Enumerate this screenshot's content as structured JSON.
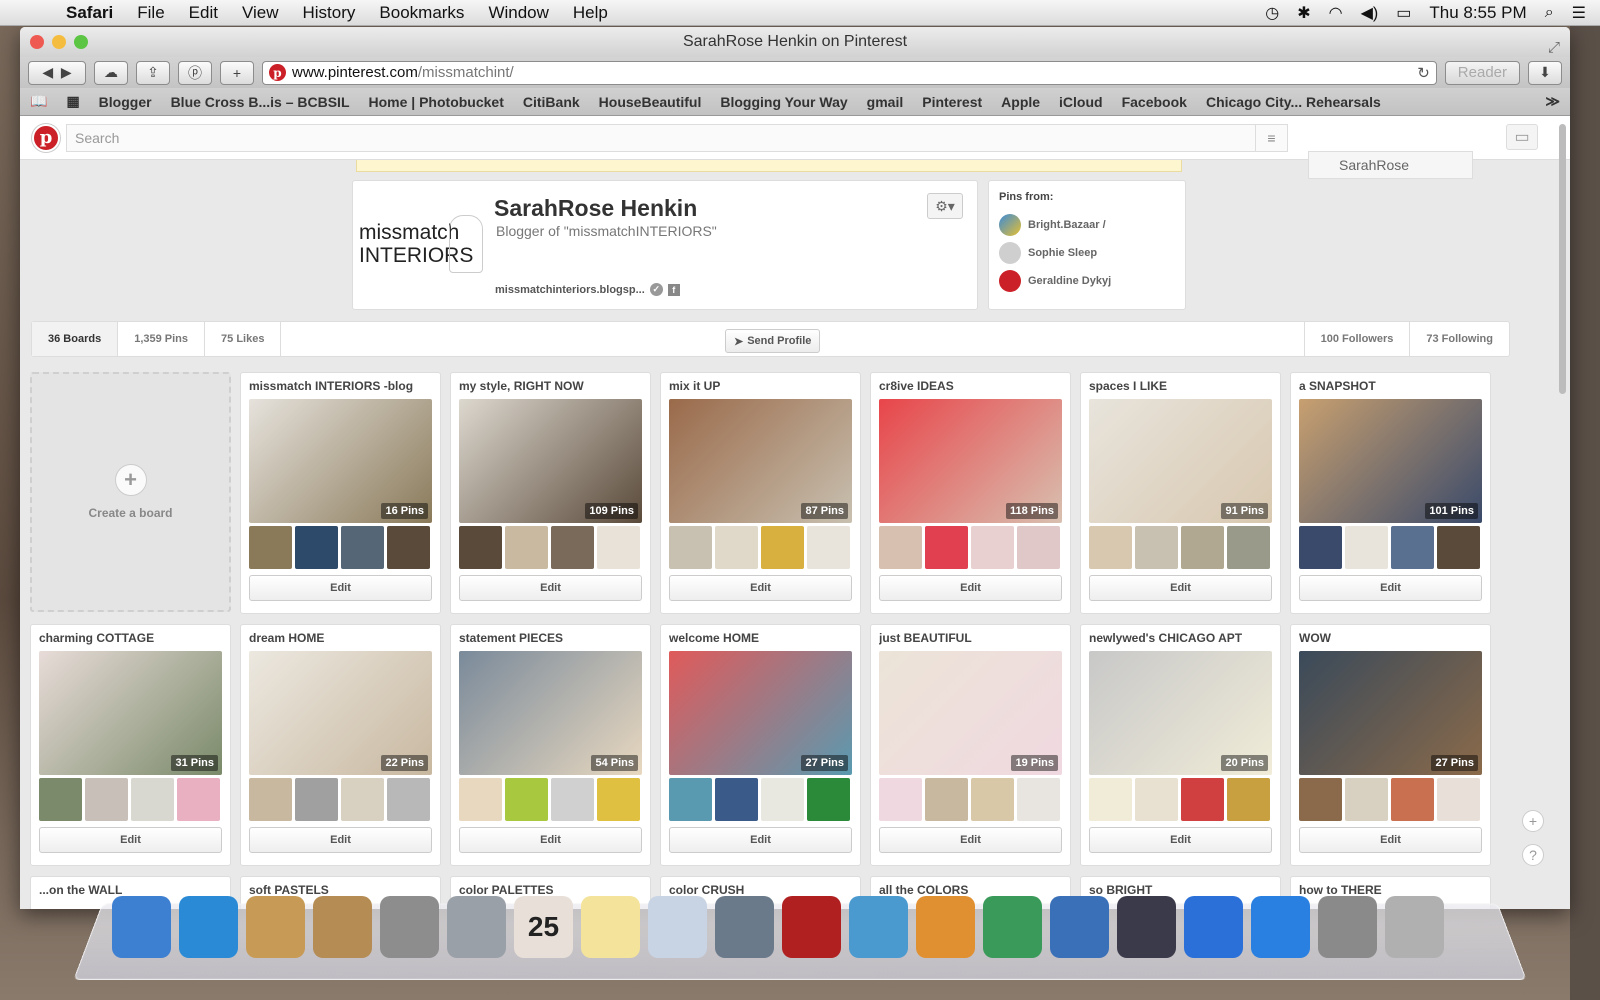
{
  "menubar": {
    "app": "Safari",
    "items": [
      "File",
      "Edit",
      "View",
      "History",
      "Bookmarks",
      "Window",
      "Help"
    ],
    "clock": "Thu 8:55 PM"
  },
  "window": {
    "title": "SarahRose Henkin on Pinterest",
    "url_host": "www.pinterest.com",
    "url_path": "/missmatchint/",
    "reader_label": "Reader"
  },
  "bookmarks": [
    "Blogger",
    "Blue Cross B...is – BCBSIL",
    "Home | Photobucket",
    "CitiBank",
    "HouseBeautiful",
    "Blogging Your Way",
    "gmail",
    "Pinterest",
    "Apple",
    "iCloud",
    "Facebook",
    "Chicago City... Rehearsals"
  ],
  "pinterest": {
    "search_placeholder": "Search",
    "user_button": "SarahRose",
    "profile": {
      "logo_line1": "missmatch",
      "logo_line2": "INTERIORS",
      "name": "SarahRose Henkin",
      "bio": "Blogger of \"missmatchINTERIORS\"",
      "link": "missmatchinteriors.blogsp..."
    },
    "pins_from": {
      "heading": "Pins from:",
      "sources": [
        "Bright.Bazaar /",
        "Sophie Sleep",
        "Geraldine Dykyj"
      ]
    },
    "tabs": {
      "boards": "36 Boards",
      "pins": "1,359 Pins",
      "likes": "75 Likes",
      "send": "Send Profile",
      "followers": "100 Followers",
      "following": "73 Following"
    },
    "create_board": "Create a board",
    "edit_label": "Edit",
    "boards": [
      {
        "title": "missmatch INTERIORS -blog",
        "count": "16 Pins",
        "colors": [
          "#e6e2dc",
          "#8a7a5a",
          "#2d4a6a",
          "#556677",
          "#5a4a3a"
        ]
      },
      {
        "title": "my style, RIGHT NOW",
        "count": "109 Pins",
        "colors": [
          "#ddd8cf",
          "#5a4a3a",
          "#c9b9a0",
          "#7a6a5a",
          "#e8e2d8"
        ]
      },
      {
        "title": "mix it UP",
        "count": "87 Pins",
        "colors": [
          "#9a6a4a",
          "#c8c0b0",
          "#e0d8c8",
          "#d8b040",
          "#e8e4dc"
        ]
      },
      {
        "title": "cr8ive IDEAS",
        "count": "118 Pins",
        "colors": [
          "#e8454a",
          "#d8c0b0",
          "#e04050",
          "#e8d0d0",
          "#e0c8c8"
        ]
      },
      {
        "title": "spaces I LIKE",
        "count": "91 Pins",
        "colors": [
          "#e8e4dc",
          "#d8c8b0",
          "#c8c0b0",
          "#b0a890",
          "#9a9a8a"
        ]
      },
      {
        "title": "a SNAPSHOT",
        "count": "101 Pins",
        "colors": [
          "#c8a070",
          "#3a4a6a",
          "#e8e4dc",
          "#5a7090",
          "#5a4a3a"
        ]
      },
      {
        "title": "charming COTTAGE",
        "count": "31 Pins",
        "colors": [
          "#e8dcd8",
          "#7a8a6a",
          "#c8c0b8",
          "#d8d8d0",
          "#e8b0c0"
        ]
      },
      {
        "title": "dream HOME",
        "count": "22 Pins",
        "colors": [
          "#ece8e0",
          "#c8b8a0",
          "#a0a0a0",
          "#d8d0c0",
          "#b8b8b8"
        ]
      },
      {
        "title": "statement PIECES",
        "count": "54 Pins",
        "colors": [
          "#7a8a9a",
          "#e8d8c0",
          "#a8c840",
          "#d0d0d0",
          "#e0c040"
        ]
      },
      {
        "title": "welcome HOME",
        "count": "27 Pins",
        "colors": [
          "#e05a5a",
          "#5a9ab0",
          "#3a5a8a",
          "#e8e8e0",
          "#2a8a3a"
        ]
      },
      {
        "title": "just BEAUTIFUL",
        "count": "19 Pins",
        "colors": [
          "#ece4d8",
          "#f0d8e0",
          "#c8b8a0",
          "#d8c8a8",
          "#e8e4e0"
        ]
      },
      {
        "title": "newlywed's CHICAGO APT",
        "count": "20 Pins",
        "colors": [
          "#c8c8c8",
          "#f0ecd8",
          "#e8e0d0",
          "#d04040",
          "#c8a040"
        ]
      },
      {
        "title": "WOW",
        "count": "27 Pins",
        "colors": [
          "#3a4a5a",
          "#8a6a4a",
          "#d8d0c0",
          "#c87050",
          "#e8e0d8"
        ]
      }
    ],
    "row3_titles": [
      "...on the WALL",
      "soft PASTELS",
      "color PALETTES",
      "color CRUSH",
      "all the COLORS",
      "so BRIGHT",
      "how to THERE"
    ]
  },
  "dock_icons": [
    "finder-icon",
    "safari-icon",
    "mail-icon",
    "contacts-icon",
    "calculator-icon",
    "launchpad-icon",
    "calendar-icon",
    "notes-icon",
    "preview-icon",
    "facetime-icon",
    "photo-booth-icon",
    "iphoto-icon",
    "pages-icon",
    "numbers-icon",
    "keynote-icon",
    "inkscape-icon",
    "itunes-icon",
    "app-store-icon",
    "system-preferences-icon",
    "trash-icon"
  ],
  "dock_colors": [
    "#3d7fd1",
    "#2a8ad6",
    "#c79a55",
    "#b58c54",
    "#8d8d8d",
    "#9aa0a8",
    "#e8e0d8",
    "#f4e39a",
    "#c8d4e4",
    "#6a7a8a",
    "#b02020",
    "#4a9ad0",
    "#e09030",
    "#3a9a5a",
    "#3a70b8",
    "#3a3a4a",
    "#2a70d8",
    "#2a80e0",
    "#8a8a8a",
    "#b0b0b0"
  ],
  "calendar_day": "25"
}
